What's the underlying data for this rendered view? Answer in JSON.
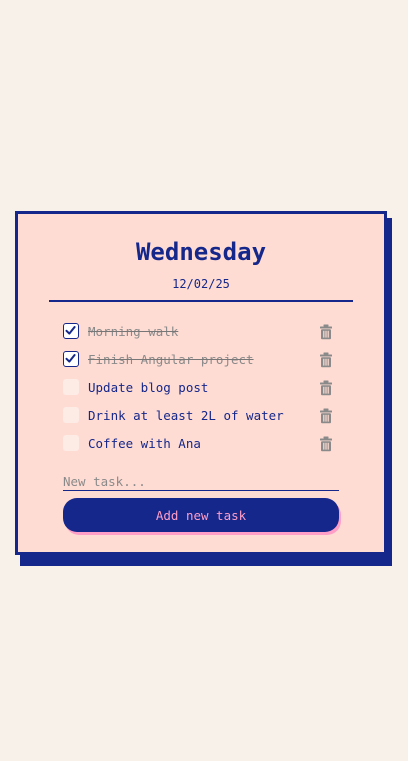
{
  "header": {
    "day": "Wednesday",
    "date": "12/02/25"
  },
  "tasks": [
    {
      "label": "Morning walk",
      "done": true
    },
    {
      "label": "Finish Angular project",
      "done": true
    },
    {
      "label": "Update blog post",
      "done": false
    },
    {
      "label": "Drink at least 2L of water",
      "done": false
    },
    {
      "label": "Coffee with Ana",
      "done": false
    }
  ],
  "new_task": {
    "value": "",
    "placeholder": "New task..."
  },
  "add_button": {
    "label": "Add new task"
  },
  "colors": {
    "background": "#f7f1ea",
    "card": "#ffdcd3",
    "primary": "#15278a",
    "accent": "#ff9ec7",
    "muted": "#8a8a8a"
  },
  "icons": {
    "check": "check-icon",
    "delete": "trash-icon"
  }
}
